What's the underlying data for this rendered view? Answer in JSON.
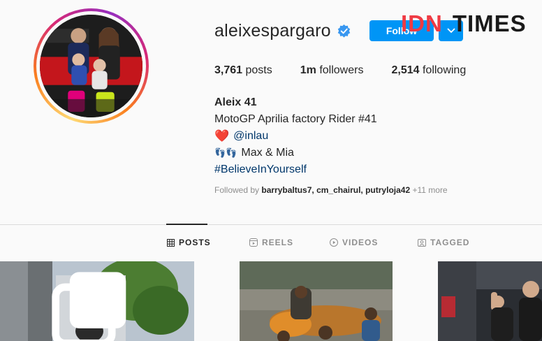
{
  "profile": {
    "username": "aleixespargaro",
    "follow_label": "Follow",
    "stats": [
      {
        "value": "3,761",
        "label": "posts"
      },
      {
        "value": "1m",
        "label": "followers"
      },
      {
        "value": "2,514",
        "label": "following"
      }
    ],
    "bio": {
      "name": "Aleix 41",
      "line1": "MotoGP Aprilia factory Rider #41",
      "heart": "❤️",
      "mention": "@inlau",
      "feet": "👣👣",
      "kids": "Max & Mia",
      "hashtag": "#BelieveInYourself"
    },
    "followed_by_prefix": "Followed by",
    "followed_by_names": "barrybaltus7, cm_chairul, putryloja42",
    "followed_by_more": "+11 more"
  },
  "watermark": {
    "part1": "IDN",
    "part2": "TIMES"
  },
  "tabs": [
    {
      "label": "POSTS",
      "icon": "grid-icon",
      "active": true
    },
    {
      "label": "REELS",
      "icon": "reels-icon",
      "active": false
    },
    {
      "label": "VIDEOS",
      "icon": "video-icon",
      "active": false
    },
    {
      "label": "TAGGED",
      "icon": "tagged-icon",
      "active": false
    }
  ],
  "colors": {
    "accent": "#0095f6",
    "text": "#262626",
    "muted": "#8e8e8e",
    "link": "#00376b",
    "watermark_red": "#ef3a43"
  }
}
